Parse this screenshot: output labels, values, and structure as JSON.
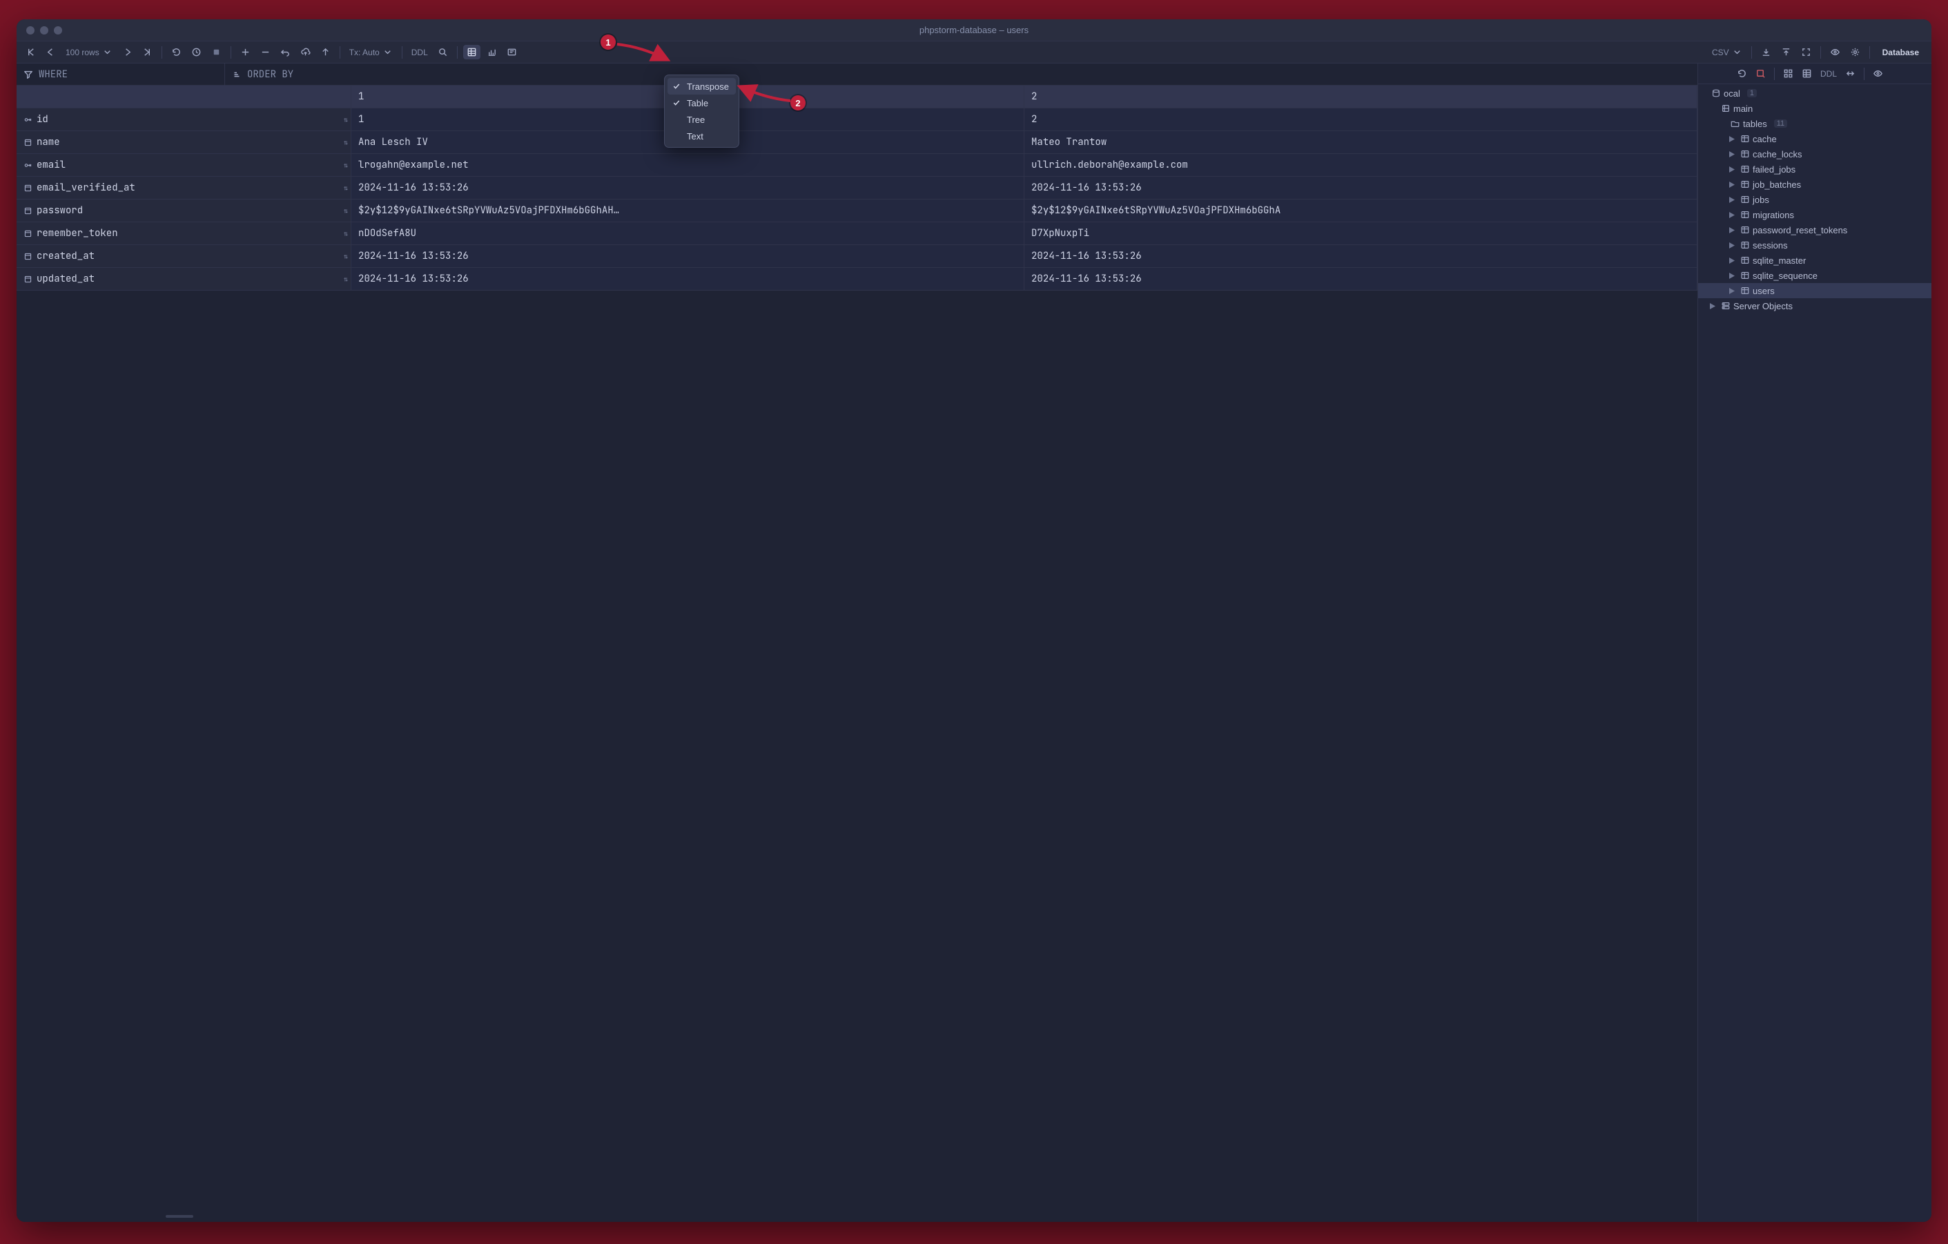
{
  "window_title": "phpstorm-database – users",
  "toolbar": {
    "rows_label": "100 rows",
    "tx_label": "Tx: Auto",
    "ddl_label": "DDL",
    "csv_label": "CSV"
  },
  "filter": {
    "where_label": "WHERE",
    "order_label": "ORDER BY"
  },
  "grid": {
    "column_headers": [
      "1",
      "2"
    ],
    "rows": [
      {
        "field": "id",
        "icon": "key",
        "values": [
          "1",
          "2"
        ]
      },
      {
        "field": "name",
        "icon": "column",
        "values": [
          "Ana Lesch IV",
          "Mateo Trantow"
        ]
      },
      {
        "field": "email",
        "icon": "key",
        "values": [
          "lrogahn@example.net",
          "ullrich.deborah@example.com"
        ]
      },
      {
        "field": "email_verified_at",
        "icon": "column",
        "values": [
          "2024-11-16 13:53:26",
          "2024-11-16 13:53:26"
        ]
      },
      {
        "field": "password",
        "icon": "column",
        "values": [
          "$2y$12$9yGAINxe6tSRpYVWuAz5VOajPFDXHm6bGGhAH…",
          "$2y$12$9yGAINxe6tSRpYVWuAz5VOajPFDXHm6bGGhA"
        ]
      },
      {
        "field": "remember_token",
        "icon": "column",
        "values": [
          "nDOdSefA8U",
          "D7XpNuxpTi"
        ]
      },
      {
        "field": "created_at",
        "icon": "column",
        "values": [
          "2024-11-16 13:53:26",
          "2024-11-16 13:53:26"
        ]
      },
      {
        "field": "updated_at",
        "icon": "column",
        "values": [
          "2024-11-16 13:53:26",
          "2024-11-16 13:53:26"
        ]
      }
    ]
  },
  "popup": {
    "items": [
      {
        "label": "Transpose",
        "checked": true,
        "highlight": true
      },
      {
        "label": "Table",
        "checked": true,
        "highlight": false
      },
      {
        "label": "Tree",
        "checked": false,
        "highlight": false
      },
      {
        "label": "Text",
        "checked": false,
        "highlight": false
      }
    ]
  },
  "sidebar": {
    "title": "Database",
    "toolbar": {
      "ddl_label": "DDL"
    },
    "tree": [
      {
        "depth": 0,
        "expand": "none",
        "icon": "db",
        "label": "ocal",
        "count": "1"
      },
      {
        "depth": 1,
        "expand": "none",
        "icon": "schema",
        "label": "main"
      },
      {
        "depth": 2,
        "expand": "none",
        "icon": "folder",
        "label": "tables",
        "count": "11"
      },
      {
        "depth": 3,
        "expand": "right",
        "icon": "table",
        "label": "cache"
      },
      {
        "depth": 3,
        "expand": "right",
        "icon": "table",
        "label": "cache_locks"
      },
      {
        "depth": 3,
        "expand": "right",
        "icon": "table",
        "label": "failed_jobs"
      },
      {
        "depth": 3,
        "expand": "right",
        "icon": "table",
        "label": "job_batches"
      },
      {
        "depth": 3,
        "expand": "right",
        "icon": "table",
        "label": "jobs"
      },
      {
        "depth": 3,
        "expand": "right",
        "icon": "table",
        "label": "migrations"
      },
      {
        "depth": 3,
        "expand": "right",
        "icon": "table",
        "label": "password_reset_tokens"
      },
      {
        "depth": 3,
        "expand": "right",
        "icon": "table",
        "label": "sessions"
      },
      {
        "depth": 3,
        "expand": "right",
        "icon": "table",
        "label": "sqlite_master"
      },
      {
        "depth": 3,
        "expand": "right",
        "icon": "table",
        "label": "sqlite_sequence"
      },
      {
        "depth": 3,
        "expand": "right",
        "icon": "table",
        "label": "users",
        "selected": true
      },
      {
        "depth": 1,
        "expand": "right",
        "icon": "server",
        "label": "Server Objects"
      }
    ]
  },
  "annotations": {
    "b1": "1",
    "b2": "2"
  }
}
